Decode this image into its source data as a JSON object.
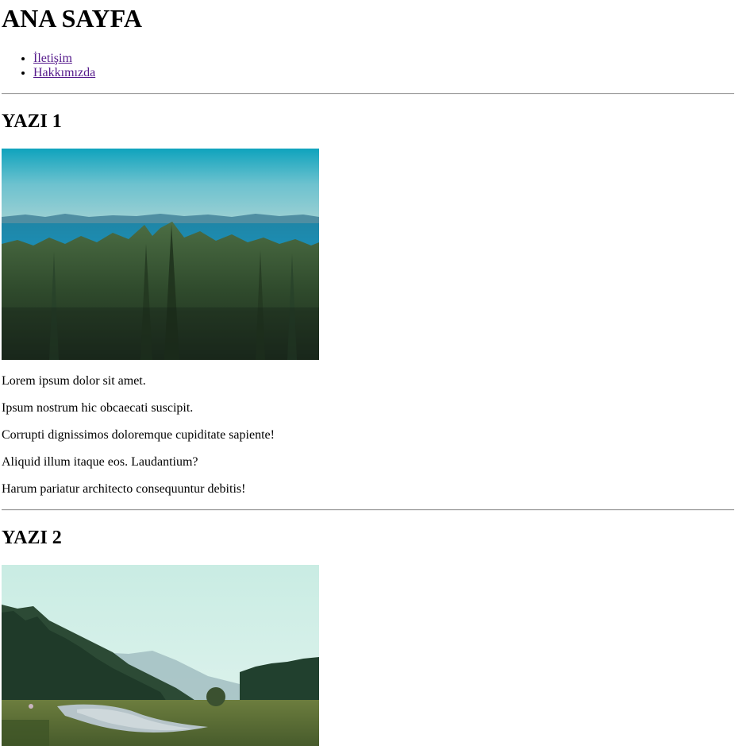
{
  "header": {
    "title": "ANA SAYFA"
  },
  "nav": {
    "items": [
      {
        "label": "İletişim"
      },
      {
        "label": "Hakkımızda"
      }
    ]
  },
  "posts": [
    {
      "title": "YAZI 1",
      "image_icon": "forest-lake-photo",
      "paragraphs": [
        "Lorem ipsum dolor sit amet.",
        "Ipsum nostrum hic obcaecati suscipit.",
        "Corrupti dignissimos doloremque cupiditate sapiente!",
        "Aliquid illum itaque eos. Laudantium?",
        "Harum pariatur architecto consequuntur debitis!"
      ]
    },
    {
      "title": "YAZI 2",
      "image_icon": "river-valley-photo",
      "paragraphs": []
    }
  ],
  "colors": {
    "link": "#551a8b",
    "divider": "#9a9a9a"
  }
}
